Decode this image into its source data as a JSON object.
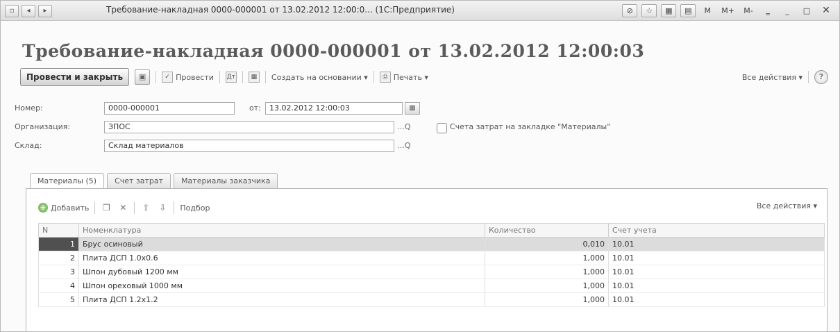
{
  "window": {
    "title": "Требование-накладная 0000-000001 от 13.02.2012 12:00:0... (1С:Предприятие)",
    "mem_buttons": [
      "M",
      "M+",
      "M-"
    ]
  },
  "document": {
    "heading": "Требование-накладная 0000-000001 от 13.02.2012 12:00:03"
  },
  "toolbar": {
    "post_close_label": "Провести и закрыть",
    "post_label": "Провести",
    "create_basis_label": "Создать на основании ▾",
    "print_label": "Печать ▾",
    "all_actions_label": "Все действия ▾",
    "help_label": "?"
  },
  "form": {
    "number_label": "Номер:",
    "number_value": "0000-000001",
    "date_label": "от:",
    "date_value": "13.02.2012 12:00:03",
    "org_label": "Организация:",
    "org_value": "ЗПОС",
    "warehouse_label": "Склад:",
    "warehouse_value": "Склад материалов",
    "cost_checkbox_label": "Счета затрат на закладке \"Материалы\"",
    "pick_button": "...Q"
  },
  "tabs": [
    {
      "label": "Материалы (5)",
      "active": true
    },
    {
      "label": "Счет затрат",
      "active": false
    },
    {
      "label": "Материалы заказчика",
      "active": false
    }
  ],
  "table_toolbar": {
    "add_label": "Добавить",
    "select_label": "Подбор",
    "all_actions_label": "Все действия ▾"
  },
  "table": {
    "columns": [
      "N",
      "Номенклатура",
      "Количество",
      "Счет учета"
    ],
    "rows": [
      {
        "n": "1",
        "item": "Брус осиновый",
        "qty": "0,010",
        "account": "10.01",
        "selected": true
      },
      {
        "n": "2",
        "item": "Плита ДСП 1.0х0.6",
        "qty": "1,000",
        "account": "10.01"
      },
      {
        "n": "3",
        "item": "Шпон дубовый 1200 мм",
        "qty": "1,000",
        "account": "10.01"
      },
      {
        "n": "4",
        "item": "Шпон ореховый 1000 мм",
        "qty": "1,000",
        "account": "10.01"
      },
      {
        "n": "5",
        "item": "Плита ДСП 1.2х1.2",
        "qty": "1,000",
        "account": "10.01"
      }
    ]
  }
}
